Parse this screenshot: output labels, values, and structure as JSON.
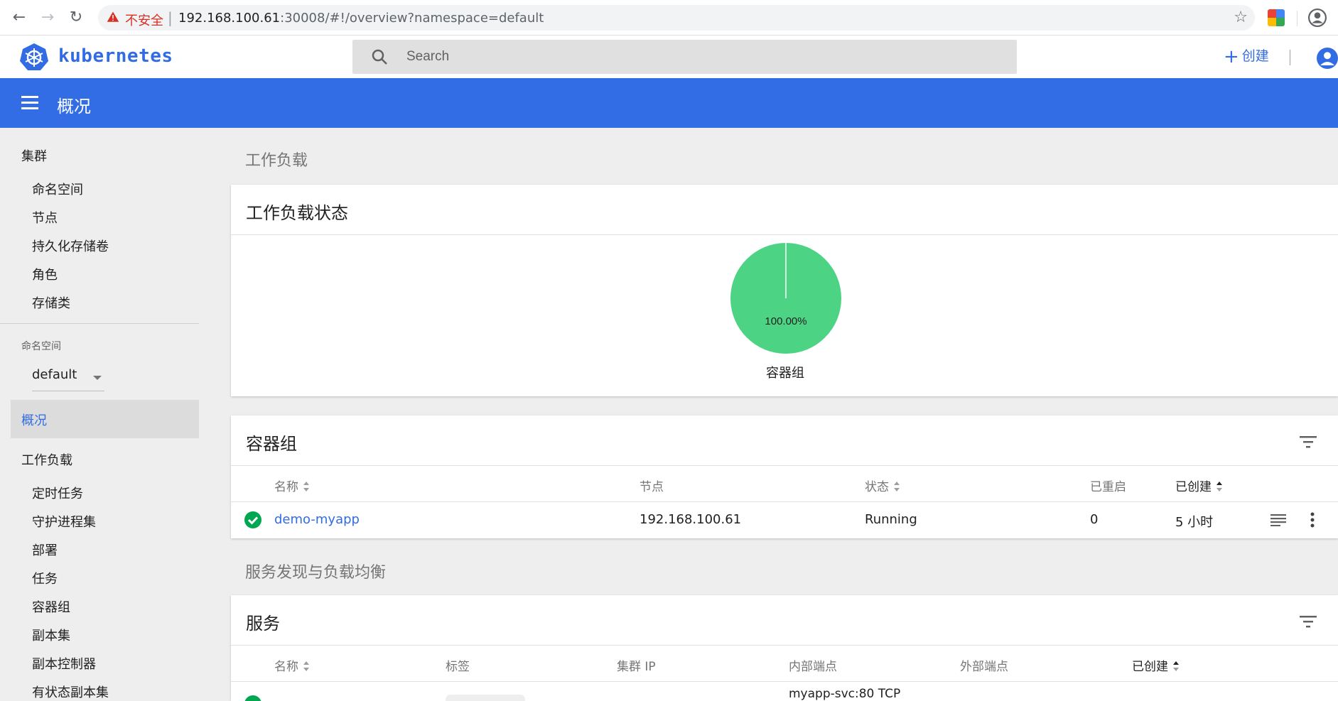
{
  "browser": {
    "insecure_label": "不安全",
    "url_host": "192.168.100.61",
    "url_rest": ":30008/#!/overview?namespace=default"
  },
  "header": {
    "brand": "kubernetes",
    "search_placeholder": "Search",
    "create_label": "创建"
  },
  "toolbar": {
    "title": "概况"
  },
  "sidebar": {
    "cluster_heading": "集群",
    "cluster_items": [
      "命名空间",
      "节点",
      "持久化存储卷",
      "角色",
      "存储类"
    ],
    "namespace_label": "命名空间",
    "namespace_value": "default",
    "active_item": "概况",
    "workloads_heading": "工作负载",
    "workload_items": [
      "定时任务",
      "守护进程集",
      "部署",
      "任务",
      "容器组",
      "副本集",
      "副本控制器",
      "有状态副本集"
    ]
  },
  "main": {
    "workloads_section": "工作负载",
    "workload_status": {
      "title": "工作负载状态",
      "pie_label": "100.00%",
      "pie_caption": "容器组",
      "running_fraction": 1.0,
      "pie_color": "#4cd384"
    },
    "pods": {
      "title": "容器组",
      "headers": {
        "name": "名称",
        "node": "节点",
        "status": "状态",
        "restarts": "已重启",
        "created": "已创建"
      },
      "rows": [
        {
          "name": "demo-myapp",
          "node": "192.168.100.61",
          "status": "Running",
          "restarts": "0",
          "created": "5 小时"
        }
      ]
    },
    "discovery_section": "服务发现与负载均衡",
    "services": {
      "title": "服务",
      "headers": {
        "name": "名称",
        "labels": "标签",
        "cluster_ip": "集群 IP",
        "internal": "内部端点",
        "external": "外部端点",
        "created": "已创建"
      },
      "rows": [
        {
          "internal": "myapp-svc:80 TCP"
        }
      ]
    }
  },
  "colors": {
    "primary": "#326ce5",
    "toolbar": "#326de6",
    "success": "#00a651",
    "insecure": "#d93025"
  }
}
